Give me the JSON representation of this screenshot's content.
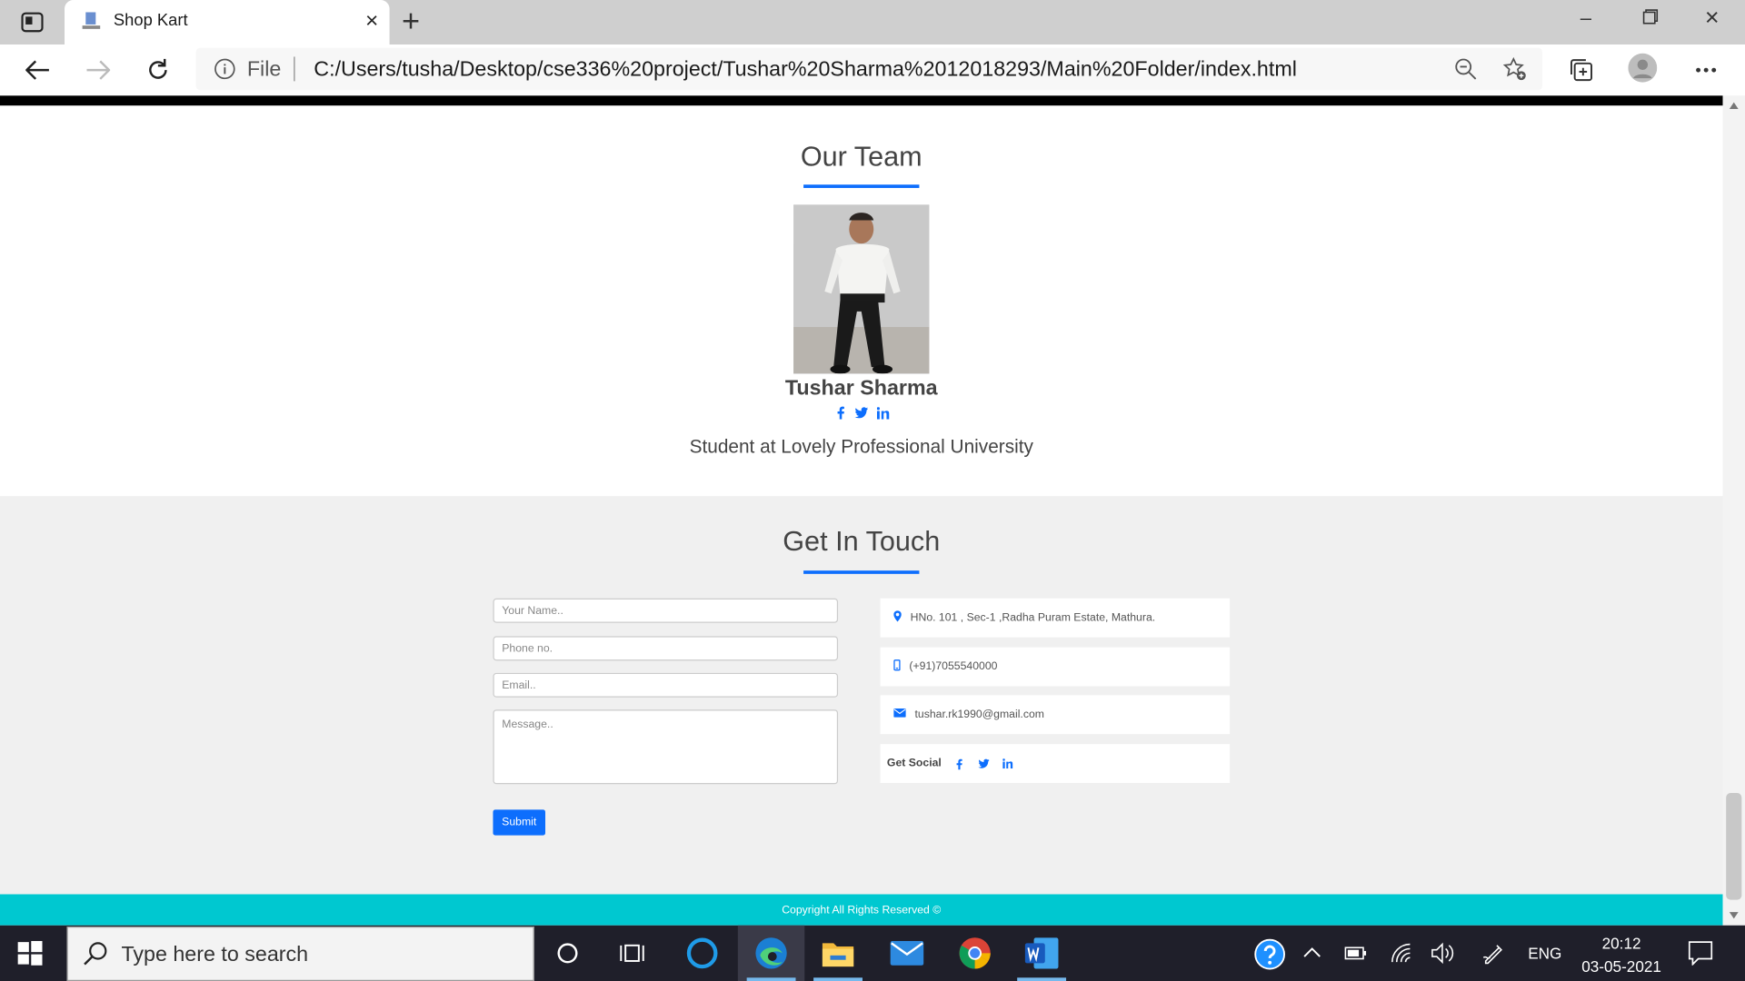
{
  "browser": {
    "tab_title": "Shop Kart",
    "address_scheme": "File",
    "url": "C:/Users/tusha/Desktop/cse336%20project/Tushar%20Sharma%2012018293/Main%20Folder/index.html"
  },
  "team": {
    "title": "Our Team",
    "member_name": "Tushar Sharma",
    "member_role": "Student at Lovely Professional University",
    "social_icons": [
      "facebook-icon",
      "twitter-icon",
      "linkedin-icon"
    ]
  },
  "contact": {
    "title": "Get In Touch",
    "form": {
      "name_placeholder": "Your Name..",
      "phone_placeholder": "Phone no.",
      "email_placeholder": "Email..",
      "message_placeholder": "Message..",
      "submit_label": "Submit"
    },
    "info": {
      "address": "HNo. 101 , Sec-1 ,Radha Puram Estate, Mathura.",
      "phone": "(+91)7055540000",
      "email": "tushar.rk1990@gmail.com",
      "social_label": "Get Social"
    }
  },
  "footer": {
    "copyright": "Copyright All Rights Reserved ©"
  },
  "taskbar": {
    "search_placeholder": "Type here to search",
    "language": "ENG",
    "time": "20:12",
    "date": "03-05-2021"
  },
  "colors": {
    "accent": "#0d6efd",
    "footer": "#00c8d0",
    "taskbar": "#1f1f2a"
  }
}
